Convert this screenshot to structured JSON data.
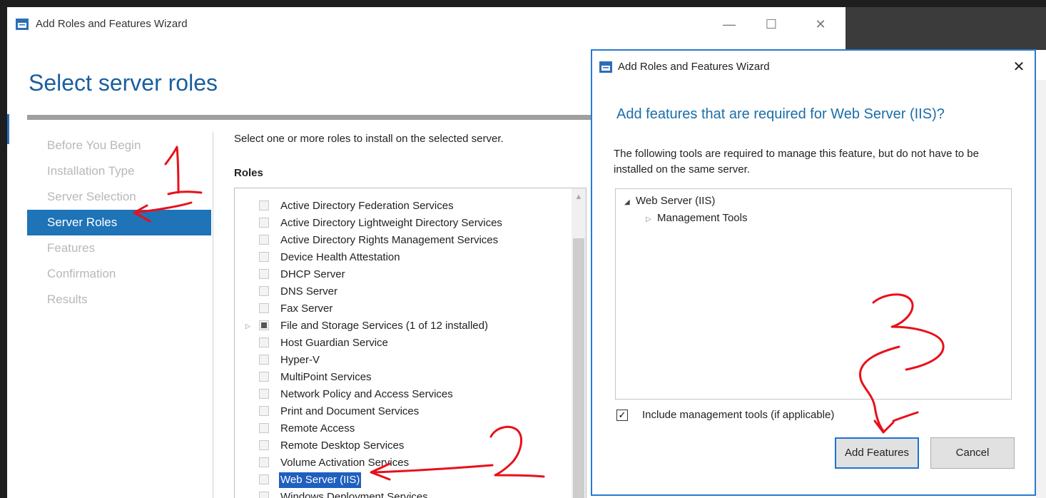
{
  "window": {
    "title": "Add Roles and Features Wizard",
    "page_heading": "Select server roles",
    "controls": {
      "minimize": "—",
      "maximize": "☐",
      "close": "✕"
    }
  },
  "steps": [
    {
      "label": "Before You Begin",
      "active": false
    },
    {
      "label": "Installation Type",
      "active": false
    },
    {
      "label": "Server Selection",
      "active": false
    },
    {
      "label": "Server Roles",
      "active": true
    },
    {
      "label": "Features",
      "active": false
    },
    {
      "label": "Confirmation",
      "active": false
    },
    {
      "label": "Results",
      "active": false
    }
  ],
  "main": {
    "instruction": "Select one or more roles to install on the selected server.",
    "roles_label": "Roles",
    "roles": [
      {
        "label": "Active Directory Federation Services"
      },
      {
        "label": "Active Directory Lightweight Directory Services"
      },
      {
        "label": "Active Directory Rights Management Services"
      },
      {
        "label": "Device Health Attestation"
      },
      {
        "label": "DHCP Server"
      },
      {
        "label": "DNS Server"
      },
      {
        "label": "Fax Server"
      },
      {
        "label": "File and Storage Services (1 of 12 installed)",
        "expandable": true,
        "partial": true
      },
      {
        "label": "Host Guardian Service"
      },
      {
        "label": "Hyper-V"
      },
      {
        "label": "MultiPoint Services"
      },
      {
        "label": "Network Policy and Access Services"
      },
      {
        "label": "Print and Document Services"
      },
      {
        "label": "Remote Access"
      },
      {
        "label": "Remote Desktop Services"
      },
      {
        "label": "Volume Activation Services"
      },
      {
        "label": "Web Server (IIS)",
        "selected": true
      },
      {
        "label": "Windows Deployment Services"
      }
    ]
  },
  "dialog": {
    "title": "Add Roles and Features Wizard",
    "close": "✕",
    "heading": "Add features that are required for Web Server (IIS)?",
    "description": "The following tools are required to manage this feature, but do not have to be installed on the same server.",
    "tree": {
      "root": "Web Server (IIS)",
      "child": "Management Tools"
    },
    "include_checkbox": {
      "label": "Include management tools (if applicable)",
      "checked": true,
      "mark": "✓"
    },
    "add_button": "Add Features",
    "cancel_button": "Cancel"
  },
  "colors": {
    "accent": "#1f73b7",
    "heading": "#1a5fa0",
    "annotation": "#e8101a"
  }
}
